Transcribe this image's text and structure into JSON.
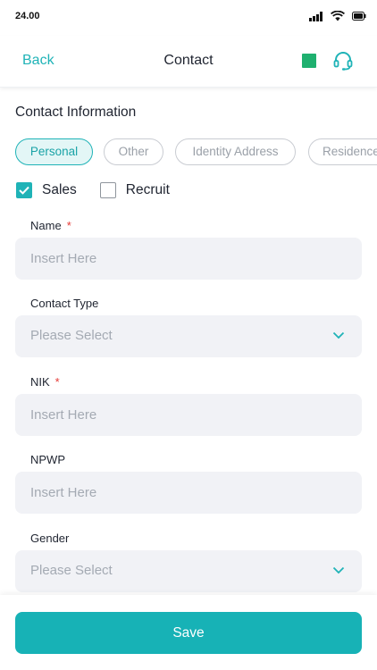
{
  "status_bar": {
    "time": "24.00"
  },
  "header": {
    "back_label": "Back",
    "title": "Contact",
    "status_color": "#1fb06f"
  },
  "section_title": "Contact Information",
  "chips": [
    {
      "label": "Personal",
      "active": true
    },
    {
      "label": "Other",
      "active": false
    },
    {
      "label": "Identity Address",
      "active": false
    },
    {
      "label": "Residence",
      "active": false
    }
  ],
  "checkboxes": [
    {
      "label": "Sales",
      "checked": true
    },
    {
      "label": "Recruit",
      "checked": false
    }
  ],
  "fields": {
    "name": {
      "label": "Name",
      "required": "*",
      "placeholder": "Insert Here"
    },
    "contact_type": {
      "label": "Contact Type",
      "placeholder": "Please Select"
    },
    "nik": {
      "label": "NIK",
      "required": "*",
      "placeholder": "Insert Here"
    },
    "npwp": {
      "label": "NPWP",
      "placeholder": "Insert Here"
    },
    "gender": {
      "label": "Gender",
      "placeholder": "Please Select"
    }
  },
  "footer": {
    "save_label": "Save"
  },
  "colors": {
    "accent": "#1fb3b7",
    "required": "#e53935",
    "field_bg": "#f1f2f6"
  },
  "icons": [
    "signal-icon",
    "wifi-icon",
    "battery-icon",
    "headset-icon",
    "chevron-down-icon",
    "check-icon"
  ]
}
